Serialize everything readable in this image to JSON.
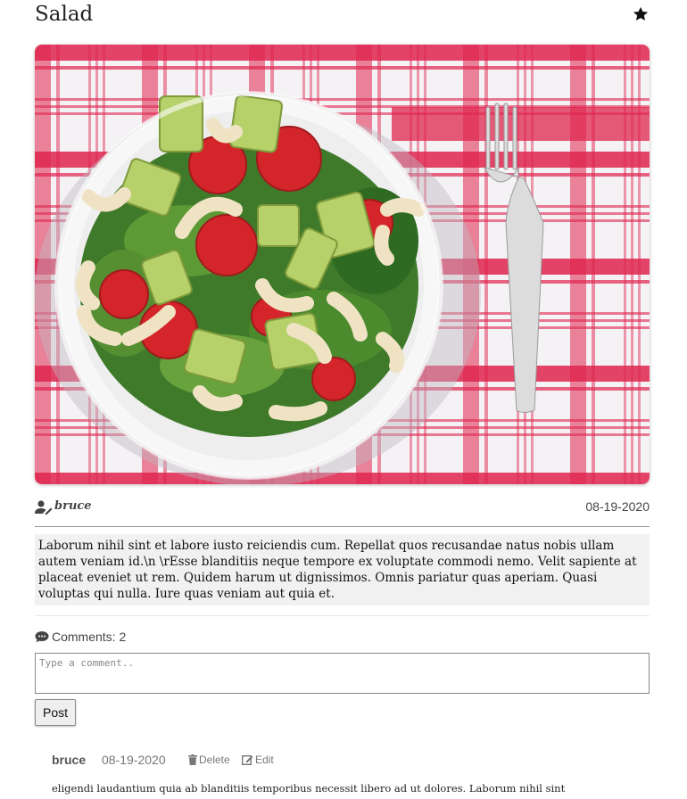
{
  "post": {
    "title": "Salad",
    "author": "bruce",
    "date": "08-19-2020",
    "body": "Laborum nihil sint et labore iusto reiciendis cum. Repellat quos recusandae natus nobis ullam autem veniam id.\\n \\rEsse blanditiis neque tempore ex voluptate commodi nemo. Velit sapiente at placeat eveniet ut rem. Quidem harum ut dignissimos. Omnis pariatur quas aperiam. Quasi voluptas qui nulla. Iure quas veniam aut quia et."
  },
  "photo": {
    "subject": "salad-bowl-photo"
  },
  "icons": {
    "favorite": "star-icon",
    "author": "user-pen-icon",
    "comments": "speech-bubble-icon",
    "delete": "trash-icon",
    "edit": "pencil-square-icon"
  },
  "colors": {
    "star": "#111111",
    "border": "#888888",
    "body_bg": "#f1f1f1"
  },
  "comments": {
    "label": "Comments: 2",
    "placeholder": "Type a comment..",
    "post_button": "Post",
    "items": [
      {
        "author": "bruce",
        "date": "08-19-2020",
        "delete_label": "Delete",
        "edit_label": "Edit",
        "text": "eligendi laudantium quia ab blanditiis temporibus necessit libero ad ut dolores. Laborum nihil sint"
      }
    ]
  }
}
